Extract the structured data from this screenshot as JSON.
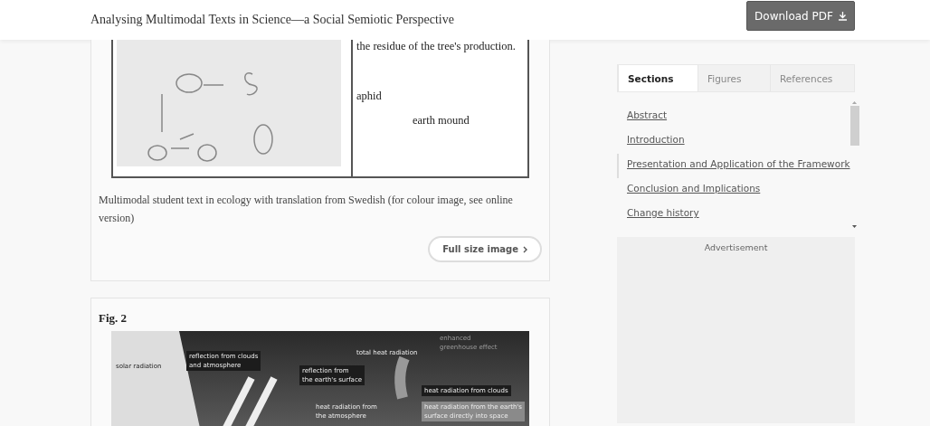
{
  "header": {
    "title": "Analysing Multimodal Texts in Science—a Social Semiotic Perspective",
    "download_button": "Download PDF"
  },
  "figure_1": {
    "table_text": "the residue of the tree's production.",
    "labels": [
      "aphid",
      "earth mound"
    ],
    "caption": "Multimodal student text in ecology with translation from Swedish (for colour image, see online version)",
    "full_size_button": "Full size image"
  },
  "figure_2": {
    "title": "Fig. 2",
    "labels": [
      {
        "text": "solar radiation",
        "kind": "dark"
      },
      {
        "text": "reflection from clouds\nand atmosphere",
        "kind": "boxed"
      },
      {
        "text": "reflection from\nthe earth's surface",
        "kind": "boxed"
      },
      {
        "text": "total heat radiation",
        "kind": "plain"
      },
      {
        "text": "enhanced\ngreenhouse effect",
        "kind": "faint"
      },
      {
        "text": "heat radiation from clouds",
        "kind": "boxed"
      },
      {
        "text": "heat radiation from\nthe atmosphere",
        "kind": "plain"
      },
      {
        "text": "heat radiation from the earth's\nsurface directly into space",
        "kind": "shaded"
      }
    ]
  },
  "sidebar": {
    "tabs": [
      {
        "label": "Sections",
        "selected": true
      },
      {
        "label": "Figures",
        "selected": false
      },
      {
        "label": "References",
        "selected": false
      }
    ],
    "sections": [
      {
        "label": "Abstract",
        "selected": false
      },
      {
        "label": "Introduction",
        "selected": false
      },
      {
        "label": "Presentation and Application of the Framework",
        "selected": true
      },
      {
        "label": "Conclusion and Implications",
        "selected": false
      },
      {
        "label": "Change history",
        "selected": false
      }
    ],
    "advertisement": "Advertisement"
  }
}
